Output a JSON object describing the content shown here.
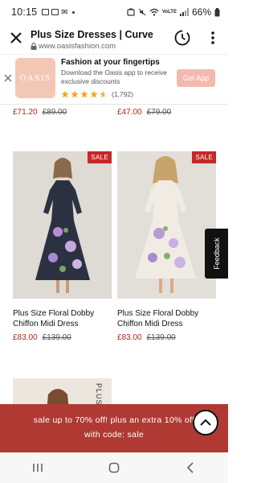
{
  "status_bar": {
    "time": "10:15",
    "network_label": "VoLTE",
    "battery": "66%"
  },
  "browser": {
    "title": "Plus Size Dresses | Curve",
    "domain": "www.oasisfashion.com"
  },
  "app_banner": {
    "logo_text": "OASIS",
    "title": "Fashion at your fingertips",
    "text": "Download the Oasis app to receive exclusive discounts",
    "rating_count": "(1,792)",
    "rating": 4.5,
    "button_label": "Get App"
  },
  "prev_row": {
    "left": {
      "price": "£71.20",
      "was": "£89.00"
    },
    "right": {
      "price": "£47.00",
      "was": "£79.00"
    }
  },
  "products": [
    {
      "badge": "SALE",
      "name": "Plus Size Floral Dobby Chiffon Midi Dress",
      "price": "£83.00",
      "was": "£139.00"
    },
    {
      "badge": "SALE",
      "name": "Plus Size Floral Dobby Chiffon Midi Dress",
      "price": "£83.00",
      "was": "£139.00"
    }
  ],
  "next_product": {
    "vertical_label": "PLUS"
  },
  "feedback_label": "Feedback",
  "promo": {
    "line1": "sale up to 70% off! plus an extra 10% off",
    "line2": "with code: sale"
  },
  "colors": {
    "sale_red": "#c62828",
    "promo_bg": "#b03a33",
    "get_app": "#f4b9ae",
    "price_red": "#b3261e"
  }
}
